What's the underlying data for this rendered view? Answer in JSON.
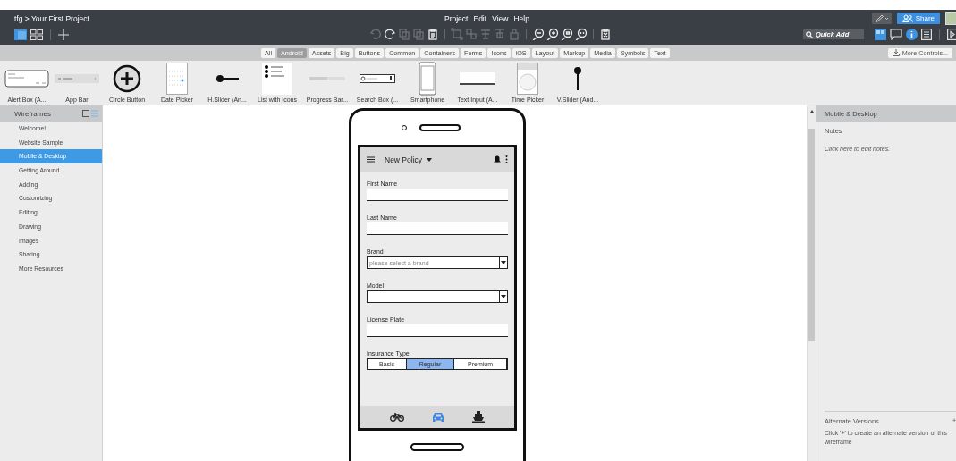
{
  "title_bar": {
    "breadcrumb": "tfg > Your First Project",
    "menu": [
      "Project",
      "Edit",
      "View",
      "Help"
    ],
    "share": "Share"
  },
  "toolbar": {
    "buttons": [
      {
        "disabled": true
      },
      {
        "disabled": false
      },
      {
        "disabled": true
      },
      {
        "disabled": true
      },
      {
        "disabled": false
      },
      {
        "disabled": true
      },
      {
        "disabled": true
      },
      {
        "disabled": true
      },
      {
        "disabled": true
      },
      {
        "disabled": true
      },
      {
        "disabled": false
      },
      {
        "disabled": false
      },
      {
        "disabled": false
      },
      {
        "disabled": false
      },
      {
        "disabled": false
      }
    ],
    "quick_add": {
      "placeholder": "Quick Add"
    }
  },
  "filter_tabs": [
    {
      "label": "All",
      "selected": false
    },
    {
      "label": "Android",
      "selected": true
    },
    {
      "label": "Assets",
      "selected": false
    },
    {
      "label": "Big",
      "selected": false
    },
    {
      "label": "Buttons",
      "selected": false
    },
    {
      "label": "Common",
      "selected": false
    },
    {
      "label": "Containers",
      "selected": false
    },
    {
      "label": "Forms",
      "selected": false
    },
    {
      "label": "Icons",
      "selected": false
    },
    {
      "label": "iOS",
      "selected": false
    },
    {
      "label": "Layout",
      "selected": false
    },
    {
      "label": "Markup",
      "selected": false
    },
    {
      "label": "Media",
      "selected": false
    },
    {
      "label": "Symbols",
      "selected": false
    },
    {
      "label": "Text",
      "selected": false
    }
  ],
  "more_controls": "More Controls...",
  "controls": [
    {
      "kind": "alert",
      "label": "Alert Box (A..."
    },
    {
      "kind": "appbar",
      "label": "App Bar"
    },
    {
      "kind": "circle",
      "label": "Circle Button"
    },
    {
      "kind": "date",
      "label": "Date Picker"
    },
    {
      "kind": "hslider",
      "label": "H.Slider (An..."
    },
    {
      "kind": "list",
      "label": "List with Icons"
    },
    {
      "kind": "progress",
      "label": "Progress Bar..."
    },
    {
      "kind": "search",
      "label": "Search Box (..."
    },
    {
      "kind": "phone",
      "label": "Smartphone"
    },
    {
      "kind": "textinput",
      "label": "Text Input (A..."
    },
    {
      "kind": "time",
      "label": "Time Picker"
    },
    {
      "kind": "vslider",
      "label": "V.Slider (And..."
    }
  ],
  "sidebar": {
    "title": "Wireframes",
    "items": [
      {
        "label": "Welcome!",
        "selected": false
      },
      {
        "label": "Website Sample",
        "selected": false
      },
      {
        "label": "Mobile & Desktop",
        "selected": true
      },
      {
        "label": "Getting Around",
        "selected": false
      },
      {
        "label": "Adding",
        "selected": false
      },
      {
        "label": "Customizing",
        "selected": false
      },
      {
        "label": "Editing",
        "selected": false
      },
      {
        "label": "Drawing",
        "selected": false
      },
      {
        "label": "Images",
        "selected": false
      },
      {
        "label": "Sharing",
        "selected": false
      },
      {
        "label": "More Resources",
        "selected": false
      }
    ]
  },
  "mockup": {
    "app_bar_title": "New Policy",
    "fields": [
      {
        "kind": "text",
        "label": "First Name"
      },
      {
        "kind": "text",
        "label": "Last Name"
      },
      {
        "kind": "dropdown",
        "label": "Brand",
        "placeholder": "please select a brand"
      },
      {
        "kind": "dropdown",
        "label": "Model"
      },
      {
        "kind": "text",
        "label": "License Plate"
      },
      {
        "kind": "segmented",
        "label": "Insurance Type",
        "options": [
          {
            "label": "Basic",
            "selected": false
          },
          {
            "label": "Regular",
            "selected": true
          },
          {
            "label": "Premium",
            "selected": false
          }
        ]
      }
    ],
    "bottom_nav": [
      {
        "kind": "bicycle",
        "selected": false
      },
      {
        "kind": "car",
        "selected": true
      },
      {
        "kind": "ship",
        "selected": false
      }
    ]
  },
  "right_panel": {
    "title": "Mobile & Desktop",
    "notes_heading": "Notes",
    "notes_placeholder": "Click here to edit notes.",
    "alternates_heading": "Alternate Versions",
    "add": "+",
    "alternates_hint": "Click '+' to create an alternate version of this wireframe"
  }
}
